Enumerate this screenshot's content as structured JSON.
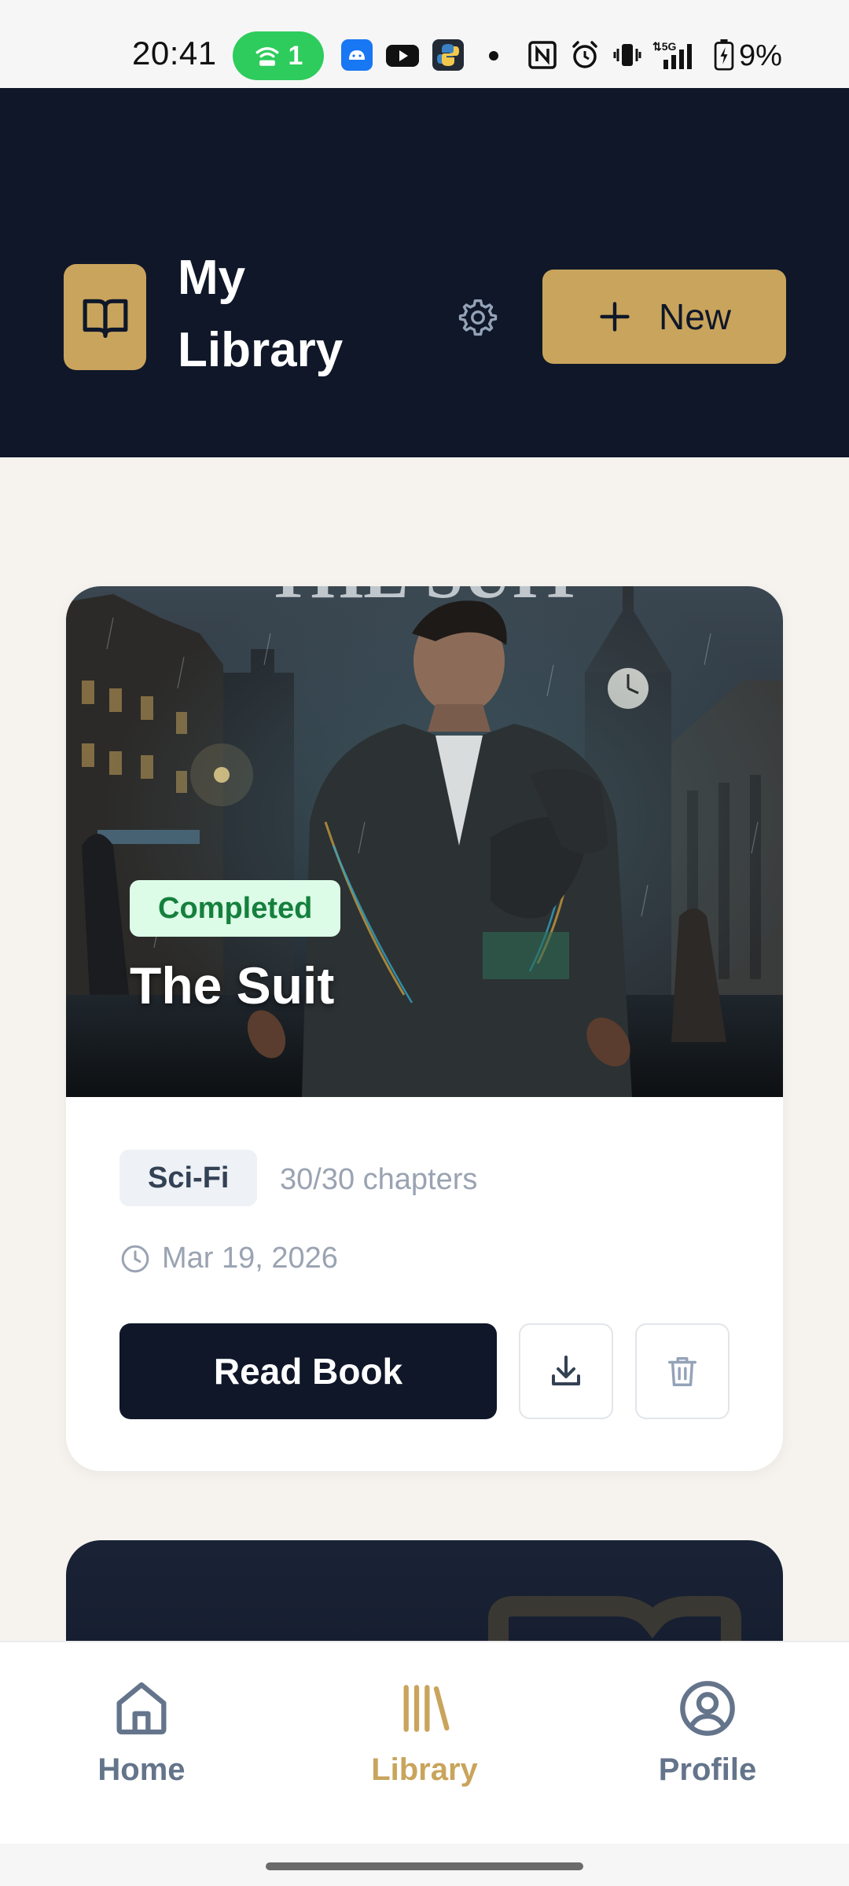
{
  "status_bar": {
    "time": "20:41",
    "hotspot_count": "1",
    "battery": "9%",
    "icons": [
      "wifi-hotspot-icon",
      "android-icon",
      "youtube-icon",
      "python-icon",
      "dot-icon",
      "nfc-icon",
      "alarm-icon",
      "vibrate-icon",
      "signal-5g-icon",
      "battery-charging-icon"
    ]
  },
  "header": {
    "title": "My Library",
    "new_label": "New",
    "colors": {
      "background": "#0f1729",
      "accent": "#c9a45c"
    }
  },
  "books": [
    {
      "cover_title_fragment": "THE SUIT",
      "status": "Completed",
      "title": "The Suit",
      "genre": "Sci-Fi",
      "chapters": "30/30 chapters",
      "date": "Mar 19, 2026",
      "read_label": "Read Book"
    }
  ],
  "bottom_nav": {
    "items": [
      {
        "label": "Home",
        "icon": "home-icon",
        "active": false
      },
      {
        "label": "Library",
        "icon": "library-icon",
        "active": true
      },
      {
        "label": "Profile",
        "icon": "profile-icon",
        "active": false
      }
    ]
  }
}
